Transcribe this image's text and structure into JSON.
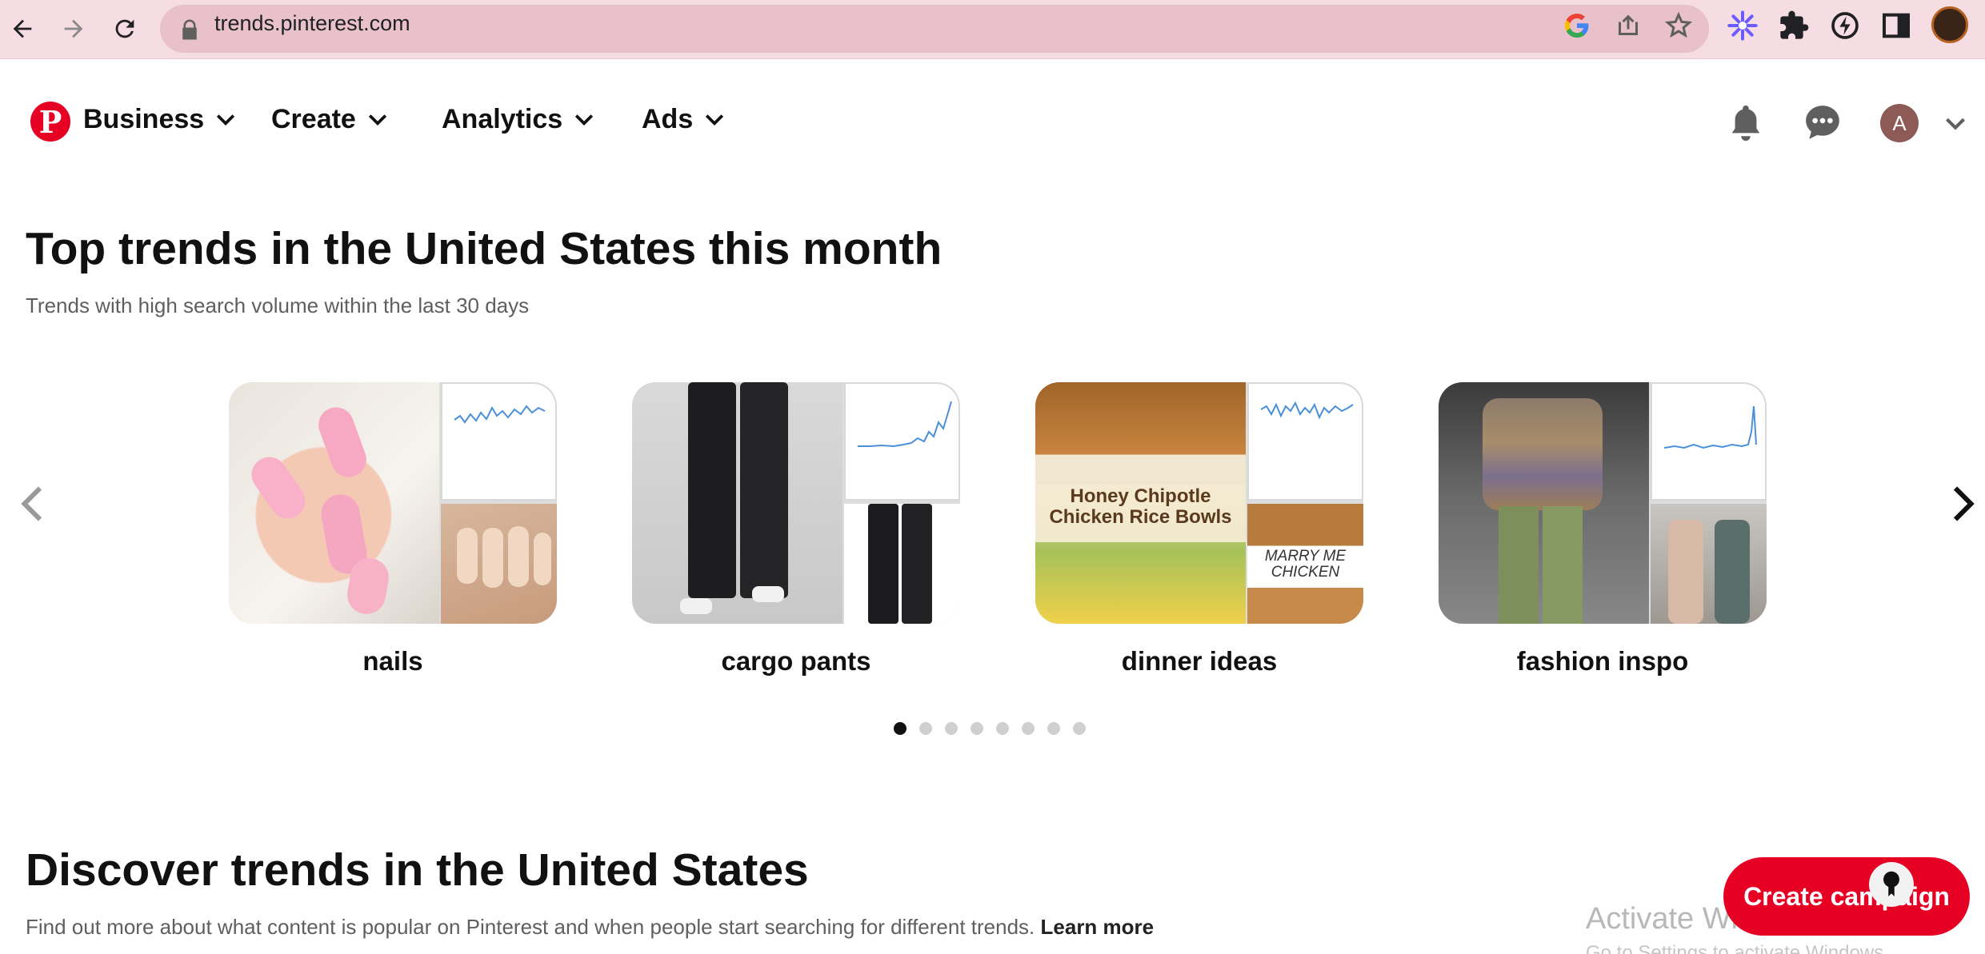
{
  "browser": {
    "url": "trends.pinterest.com",
    "icons": [
      "back-icon",
      "forward-icon",
      "reload-icon",
      "lock-icon",
      "google-icon",
      "share-icon",
      "bookmark-star-icon",
      "extension-flower-icon",
      "puzzle-icon",
      "bolt-icon",
      "sidepanel-icon",
      "profile-icon"
    ]
  },
  "header": {
    "logo": "P",
    "menus": [
      "Business",
      "Create",
      "Analytics",
      "Ads"
    ],
    "avatar_initial": "A"
  },
  "top_trends": {
    "title": "Top trends in the United States this month",
    "subtitle": "Trends with high search volume within the last 30 days",
    "cards": [
      {
        "label": "nails"
      },
      {
        "label": "cargo pants"
      },
      {
        "label": "dinner ideas",
        "overlay1": "Honey Chipotle",
        "overlay2": "Chicken Rice Bowls",
        "overlay3": "MARRY ME",
        "overlay4": "CHICKEN"
      },
      {
        "label": "fashion inspo"
      }
    ],
    "pagination_count": 8,
    "active_page": 1
  },
  "discover": {
    "title": "Discover trends in the United States",
    "subtitle": "Find out more about what content is popular on Pinterest and when people start searching for different trends.",
    "learn_more": "Learn more"
  },
  "cta": {
    "label": "Create campaign"
  },
  "watermark": {
    "line1": "Activate Windows",
    "line2": "Go to Settings to activate Windows."
  },
  "colors": {
    "brand": "#e60023",
    "chrome": "#f6dde3",
    "trend_line": "#4a90d9"
  }
}
